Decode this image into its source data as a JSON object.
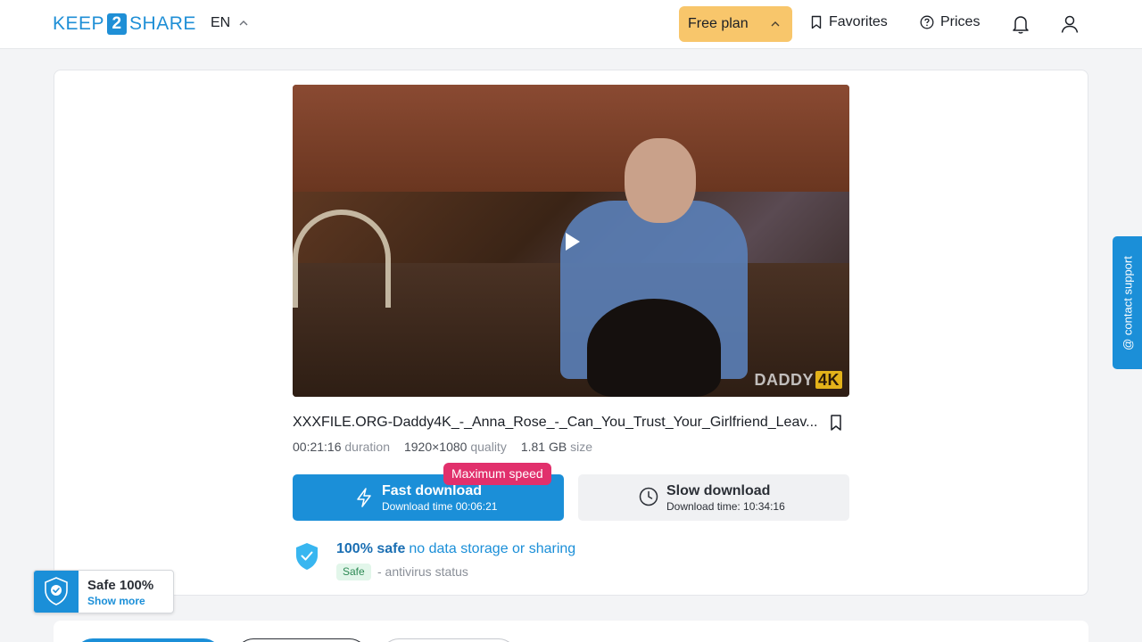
{
  "header": {
    "logo_left": "KEEP",
    "logo_num": "2",
    "logo_right": "SHARE",
    "language": "EN",
    "free_plan": "Free plan",
    "favorites": "Favorites",
    "prices": "Prices"
  },
  "video": {
    "watermark": "DADDY",
    "watermark_badge": "4K"
  },
  "file": {
    "name": "XXXFILE.ORG-Daddy4K_-_Anna_Rose_-_Can_You_Trust_Your_Girlfriend_Leav...",
    "duration_value": "00:21:16",
    "duration_label": "duration",
    "quality_value": "1920×1080",
    "quality_label": "quality",
    "size_value": "1.81 GB",
    "size_label": "size"
  },
  "fast_download": {
    "badge": "Maximum speed",
    "title": "Fast download",
    "subtitle": "Download time 00:06:21"
  },
  "slow_download": {
    "title": "Slow download",
    "subtitle": "Download time: 10:34:16"
  },
  "safety": {
    "bold": "100% safe",
    "note": "no data storage or sharing",
    "pill": "Safe",
    "status": "- antivirus status"
  },
  "support": {
    "label": "@ contact support"
  },
  "safe_badge": {
    "title": "Safe 100%",
    "link": "Show more"
  },
  "colors": {
    "brand_blue": "#1b8fd8",
    "plan_yellow": "#f8c66b",
    "badge_pink": "#e1306c"
  }
}
